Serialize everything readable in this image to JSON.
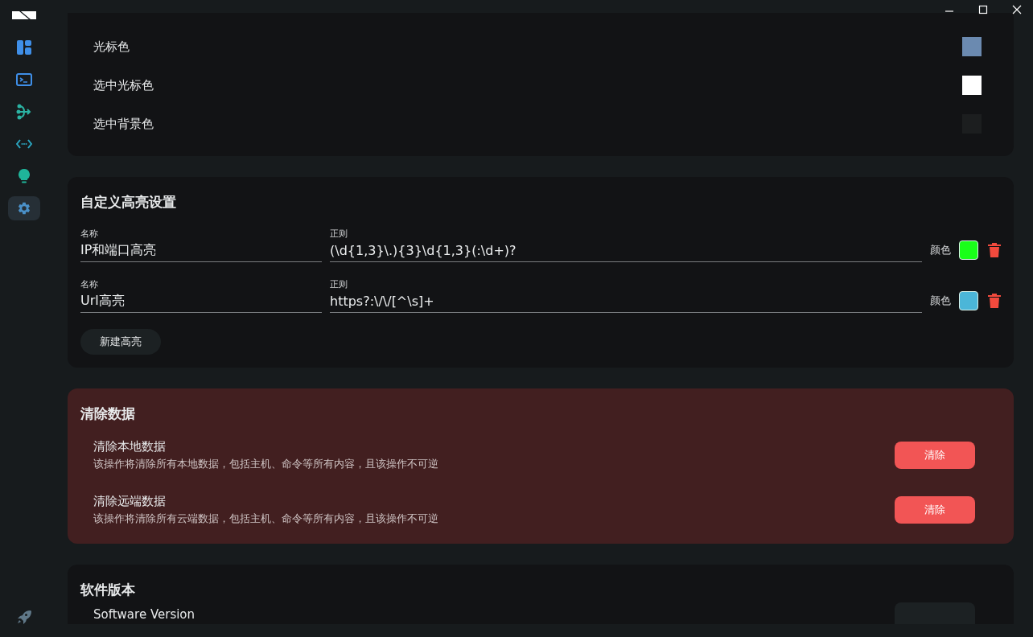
{
  "sidebar": {
    "items": [
      {
        "selected": false
      },
      {
        "selected": false
      },
      {
        "selected": false
      },
      {
        "selected": false
      },
      {
        "selected": false
      },
      {
        "selected": true
      }
    ]
  },
  "terminal_colors": {
    "rows": [
      {
        "label": "光标色",
        "color": "#6b8ab0"
      },
      {
        "label": "选中光标色",
        "color": "#ffffff"
      },
      {
        "label": "选中背景色",
        "color": "#1c1e1f"
      }
    ]
  },
  "highlights": {
    "title": "自定义高亮设置",
    "rows": [
      {
        "name_label": "名称",
        "name": "IP和端口高亮",
        "regex_label": "正则",
        "regex": "(\\d{1,3}\\.){3}\\d{1,3}(:\\d+)?",
        "color_label": "颜色",
        "color": "#19ff19"
      },
      {
        "name_label": "名称",
        "name": "Url高亮",
        "regex_label": "正则",
        "regex": "https?:\\/\\/[^\\s]+",
        "color_label": "颜色",
        "color": "#4bb6d8"
      }
    ],
    "add_button": "新建高亮"
  },
  "clear_data": {
    "title": "清除数据",
    "rows": [
      {
        "title": "清除本地数据",
        "description": "该操作将清除所有本地数据，包括主机、命令等所有内容，且该操作不可逆",
        "button": "清除"
      },
      {
        "title": "清除远端数据",
        "description": "该操作将清除所有云端数据，包括主机、命令等所有内容，且该操作不可逆",
        "button": "清除"
      }
    ]
  },
  "version": {
    "title": "软件版本",
    "label": "Software Version"
  }
}
